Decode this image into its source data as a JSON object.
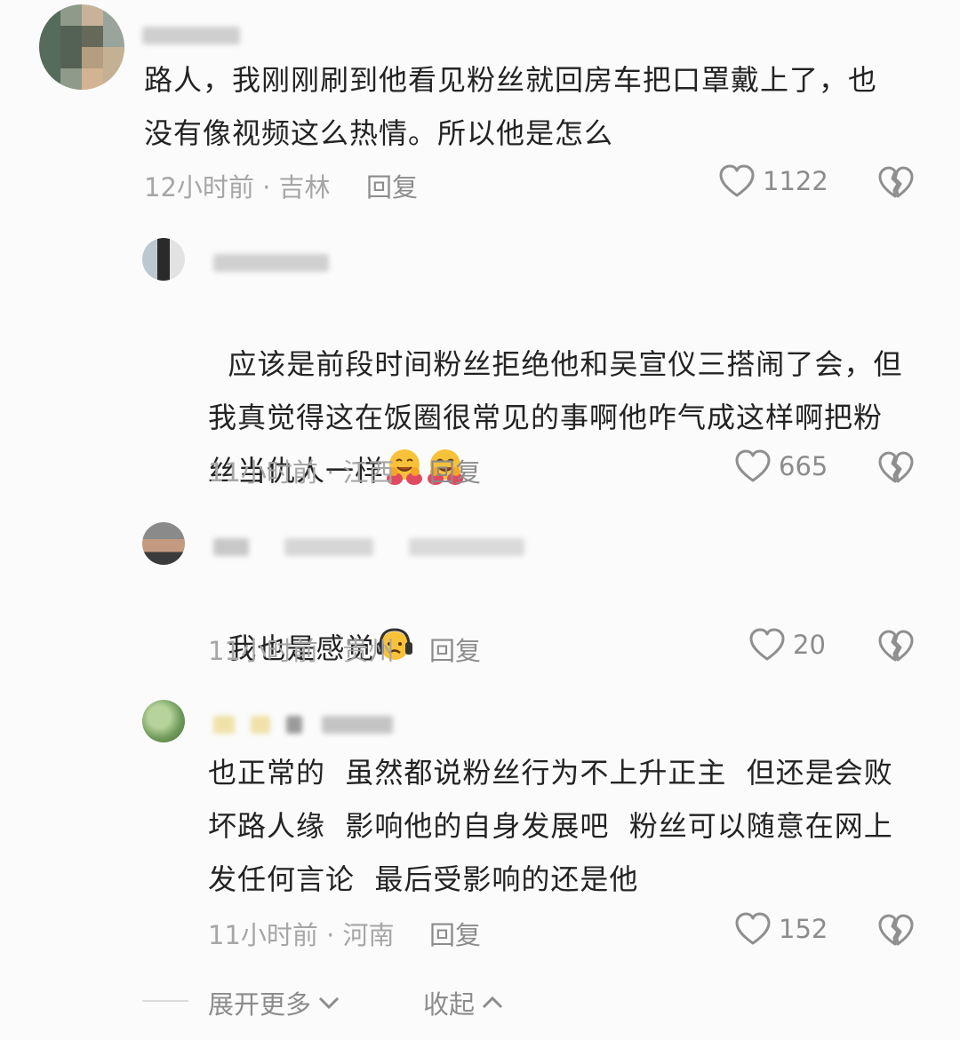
{
  "comments": [
    {
      "text": "路人，我刚刚刷到他看见粉丝就回房车把口罩戴上了，也\n没有像视频这么热情。所以他是怎么",
      "meta": "12小时前 · 吉林",
      "reply": "回复",
      "likes": "1122"
    },
    {
      "text": "应该是前段时间粉丝拒绝他和吴宣仪三搭闹了会，但\n我真觉得这在饭圈很常见的事啊他咋气成这样啊把粉\n丝当仇人一样",
      "meta": "11小时前 · 江西",
      "reply": "回复",
      "likes": "665"
    },
    {
      "text": "我也是感觉",
      "meta": "11小时前 · 贵州",
      "reply": "回复",
      "likes": "20"
    },
    {
      "text": "也正常的  虽然都说粉丝行为不上升正主  但还是会败\n坏路人缘  影响他的自身发展吧  粉丝可以随意在网上\n发任何言论  最后受影响的还是他",
      "meta": "11小时前 · 河南",
      "reply": "回复",
      "likes": "152"
    }
  ],
  "footer": {
    "expand_label": "展开更多",
    "collapse_label": "收起"
  },
  "icons": {
    "like": "heart-outline-icon",
    "dislike": "broken-heart-icon",
    "hug_emoji": "hugging-face-emoji",
    "headphones_emoji": "headphones-face-emoji",
    "expand": "chevron-down-icon",
    "collapse": "chevron-up-icon"
  }
}
